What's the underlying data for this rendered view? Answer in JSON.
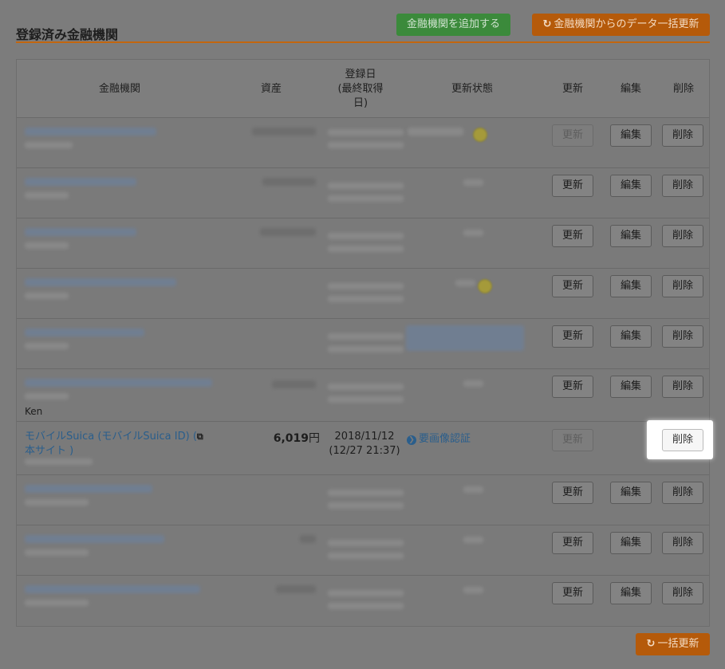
{
  "header": {
    "title": "登録済み金融機関",
    "add_button": "金融機関を追加する",
    "bulk_update_all_button": "金融機関からのデータ一括更新"
  },
  "table": {
    "columns": [
      "金融機関",
      "資産",
      "登録日\n(最終取得\n日)",
      "更新状態",
      "更新",
      "編集",
      "削除"
    ],
    "row_buttons": {
      "update": "更新",
      "edit": "編集",
      "delete": "削除"
    },
    "rows_partial_text": {
      "row6_owner": "Ken"
    },
    "highlight_row": {
      "name_line1": "モバイルSuica (モバイルSuica ID) (",
      "name_line2": "本サイト )",
      "asset_value": "6,019",
      "asset_unit": "円",
      "date_registered": "2018/11/12",
      "date_last": "(12/27 21:37)",
      "status": "要画像認証",
      "update_button": "更新",
      "delete_button": "削除"
    }
  },
  "footer": {
    "bulk_update_button": "一括更新"
  },
  "icons": {
    "refresh": "refresh-icon",
    "new_window": "new-window-icon",
    "arrow_circle": "arrow-right-circle-icon"
  },
  "colors": {
    "accent_orange": "#e07a1b",
    "green": "#58b058",
    "link_blue": "#337ab7"
  }
}
